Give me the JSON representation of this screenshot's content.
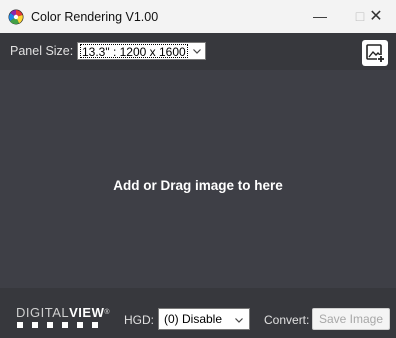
{
  "window": {
    "title": "Color Rendering V1.00",
    "controls": {
      "minimize": "—",
      "maximize": "□",
      "close": "✕"
    }
  },
  "toolbar": {
    "panel_size_label": "Panel Size:",
    "panel_size_value": "13.3\" : 1200 x 1600",
    "add_image_icon": "image-add-icon"
  },
  "drop_area": {
    "text": "Add or Drag image to here"
  },
  "bottom": {
    "logo_thin": "DIGITAL",
    "logo_bold": "VIEW",
    "logo_mark": "®",
    "hgd_label": "HGD:",
    "hgd_value": "(0) Disable",
    "convert_label": "Convert:",
    "save_button": "Save Image"
  },
  "colors": {
    "background": "#37383d",
    "drop_area": "#3e3f46",
    "titlebar": "#f3f3f3",
    "text_light": "#e0e0e0",
    "disabled_text": "#a8a8a8"
  }
}
